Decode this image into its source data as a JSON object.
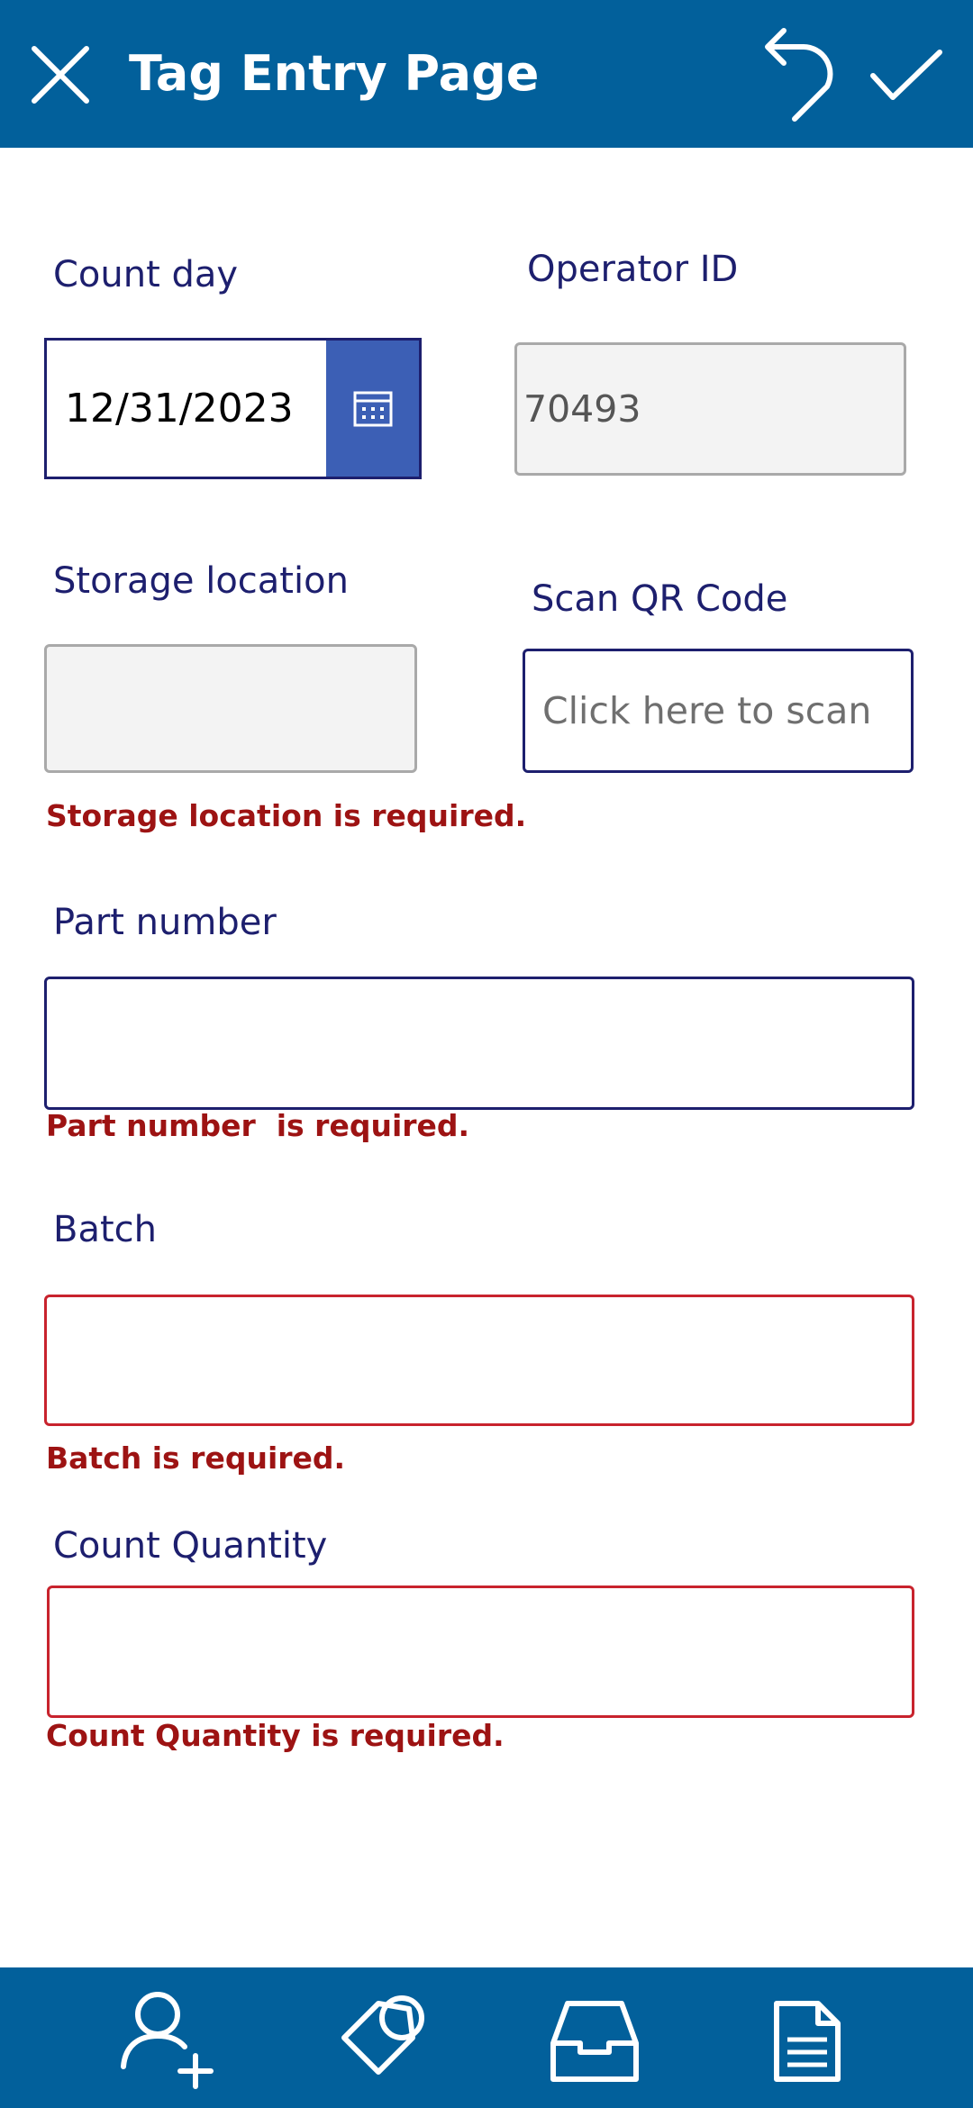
{
  "header": {
    "title": "Tag Entry Page",
    "close_icon": "close-icon",
    "undo_icon": "undo-icon",
    "confirm_icon": "checkmark-icon"
  },
  "form": {
    "count_day": {
      "label": "Count day",
      "value": "12/31/2023",
      "icon": "calendar-icon"
    },
    "operator_id": {
      "label": "Operator ID",
      "value": "70493"
    },
    "storage_location": {
      "label": "Storage location",
      "value": "",
      "error": "Storage location is required."
    },
    "scan_qr": {
      "label": "Scan QR Code",
      "placeholder": "Click here to scan"
    },
    "part_number": {
      "label": "Part number",
      "value": "",
      "error": "Part number  is required."
    },
    "batch": {
      "label": "Batch",
      "value": "",
      "error": "Batch is required."
    },
    "count_quantity": {
      "label": "Count Quantity",
      "value": "",
      "error": "Count Quantity is required."
    }
  },
  "footer": {
    "items": [
      {
        "icon": "add-user-icon"
      },
      {
        "icon": "tag-icon"
      },
      {
        "icon": "inbox-icon"
      },
      {
        "icon": "document-icon"
      }
    ]
  },
  "colors": {
    "header_bg": "#02609b",
    "label": "#1d1f6e",
    "error": "#9d1313",
    "error_border": "#c8232d",
    "calendar_button": "#3c5fb5"
  }
}
